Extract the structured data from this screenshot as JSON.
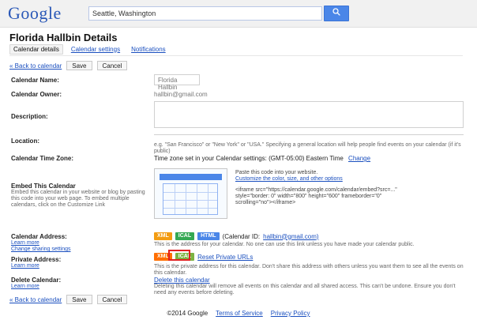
{
  "header": {
    "logo_text": "Google",
    "search_value": "Seattle, Washington"
  },
  "page": {
    "title": "Florida Hallbin Details",
    "tabs": [
      {
        "label": "Calendar details",
        "active": true
      },
      {
        "label": "Calendar settings",
        "active": false
      },
      {
        "label": "Notifications",
        "active": false
      }
    ],
    "top_actions": {
      "back_link": "« Back to calendar",
      "save": "Save",
      "cancel": "Cancel"
    },
    "bottom_actions": {
      "back_link": "« Back to calendar",
      "save": "Save",
      "cancel": "Cancel"
    }
  },
  "form": {
    "calendar_name": {
      "label": "Calendar Name:",
      "value": "Florida Hallbin"
    },
    "calendar_owner": {
      "label": "Calendar Owner:",
      "value": "hallbin@gmail.com"
    },
    "description": {
      "label": "Description:"
    },
    "location": {
      "label": "Location:",
      "hint": "e.g. \"San Francisco\" or \"New York\" or \"USA.\" Specifying a general location will help people find events on your calendar (if it's public)"
    },
    "time_zone": {
      "label": "Calendar Time Zone:",
      "value": "Time zone set in your Calendar settings: (GMT-05:00) Eastern Time",
      "link": "Change"
    },
    "embed": {
      "label": "Embed This Calendar",
      "sub": "Embed this calendar in your website or blog by pasting this code into your web page. To embed multiple calendars, click on the Customize Link",
      "preview_title": "Paste this code into your website.",
      "preview_link": "Customize the color, size, and other options",
      "preview_lines": [
        "<iframe src=\"https://calendar.google.com/calendar/embed?src=...\"",
        "style=\"border: 0\" width=\"800\" height=\"600\" frameborder=\"0\"",
        "scrolling=\"no\"></iframe>"
      ]
    },
    "calendar_address": {
      "label": "Calendar Address:",
      "sub_lines": [
        "Learn more",
        "Change sharing settings"
      ],
      "badges": [
        {
          "text": "XML",
          "color": "orange"
        },
        {
          "text": "ICAL",
          "color": "green"
        },
        {
          "text": "HTML",
          "color": "blue"
        }
      ],
      "calendar_id_prefix": "(Calendar ID:",
      "calendar_id": "hallbin@gmail.com)",
      "hint": "This is the address for your calendar. No one can use this link unless you have made your calendar public."
    },
    "private_address": {
      "label": "Private Address:",
      "sub_lines": [
        "Learn more"
      ],
      "badges": [
        {
          "text": "XML",
          "color": "red"
        },
        {
          "text": "ICAL",
          "color": "lime"
        }
      ],
      "reset_link": "Reset Private URLs",
      "hint": "This is the private address for this calendar. Don't share this address with others unless you want them to see all the events on this calendar."
    },
    "delete_calendar": {
      "label": "Delete Calendar:",
      "sub_lines": [
        "Learn more"
      ],
      "link": "Delete this calendar",
      "hint": "Deleting this calendar will remove all events on this calendar and all shared access. This can't be undone. Ensure you don't need any events before deleting."
    }
  },
  "footer": {
    "links": [
      "©2014 Google",
      "Terms of Service",
      "Privacy Policy"
    ]
  }
}
